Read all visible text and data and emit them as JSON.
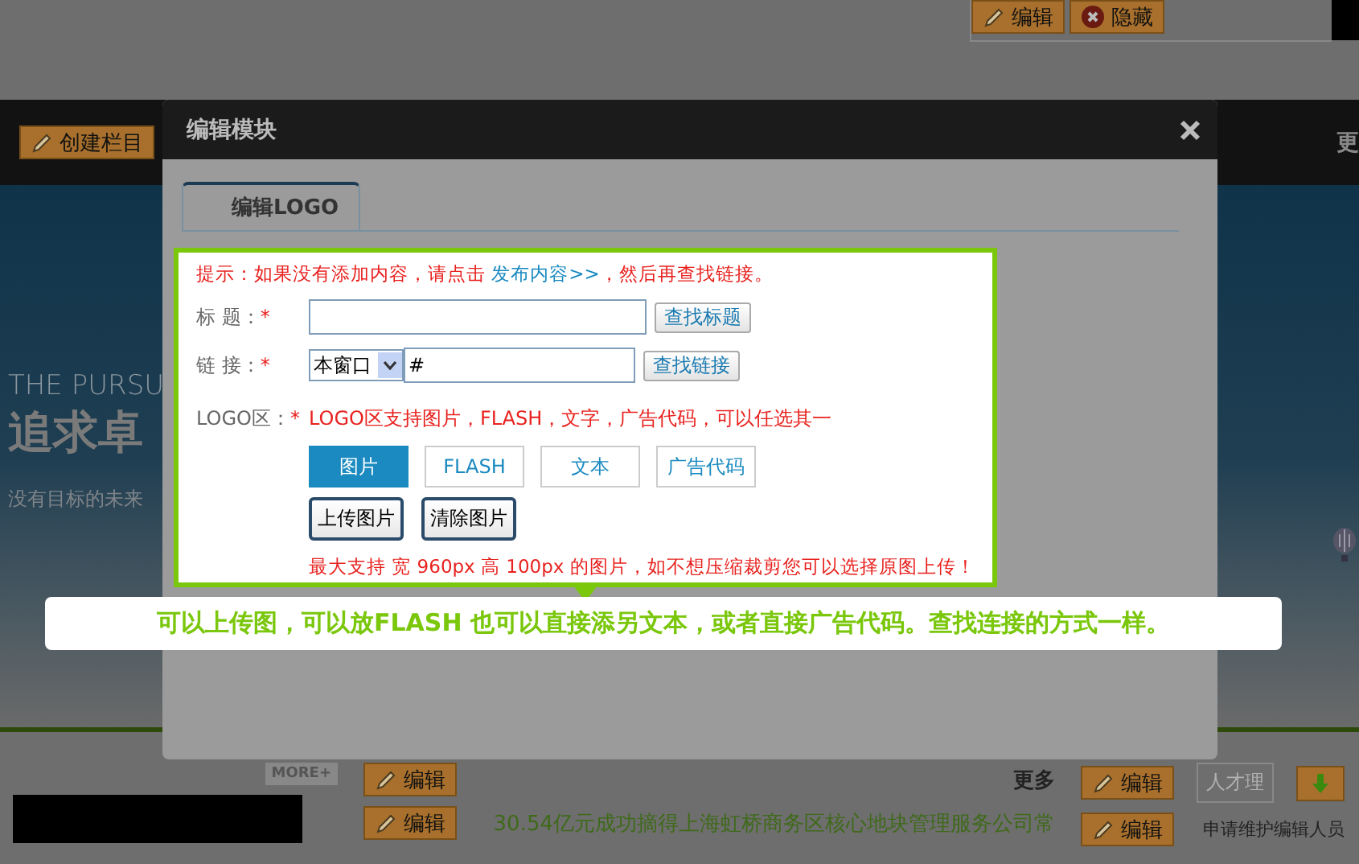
{
  "page": {
    "top_buttons": [
      {
        "label": "编辑",
        "kind": "edit"
      },
      {
        "label": "隐藏",
        "kind": "hide"
      }
    ],
    "nav": {
      "create_button": "创建栏目",
      "more": "更"
    },
    "banner": {
      "title_en": "THE PURSU",
      "title_cn": "追求卓",
      "subtitle": "没有目标的未来"
    },
    "bottom": {
      "more_badge": "MORE+",
      "edit_buttons": [
        "编辑",
        "编辑",
        "编辑",
        "编辑"
      ],
      "more_link": "更多",
      "tab": "人才理",
      "news": "30.54亿元成功摘得上海虹桥商务区核心地块管理服务公司常",
      "side_text": "申请维护编辑人员"
    }
  },
  "dialog": {
    "title": "编辑模块",
    "tabs": [
      {
        "label": "编辑LOGO",
        "selected": true
      }
    ],
    "hint": {
      "text": "提示：如果没有添加内容，请点击 ",
      "link": "发布内容>>",
      "suffix": "，然后再查找链接。"
    },
    "fields": [
      {
        "kind": "text",
        "label": "标 题：",
        "mark": "*",
        "button": "查找标题"
      },
      {
        "kind": "link",
        "label": "链 接：",
        "mark": "*",
        "select": "本窗口",
        "value": "#",
        "button": "查找链接"
      }
    ],
    "logo": {
      "label": "LOGO区：",
      "mark": "*",
      "note": "LOGO区支持图片，FLASH，文字，广告代码，可以任选其一",
      "types": [
        {
          "label": "图片",
          "selected": true
        },
        {
          "label": "FLASH",
          "selected": false
        },
        {
          "label": "文本",
          "selected": false
        },
        {
          "label": "广告代码",
          "selected": false
        }
      ],
      "buttons": [
        "上传图片",
        "清除图片"
      ],
      "limit": "最大支持 宽 960px 高 100px 的图片，如不想压缩裁剪您可以选择原图上传！"
    }
  },
  "callout": "可以上传图，可以放FLASH 也可以直接添另文本，或者直接广告代码。查找连接的方式一样。"
}
